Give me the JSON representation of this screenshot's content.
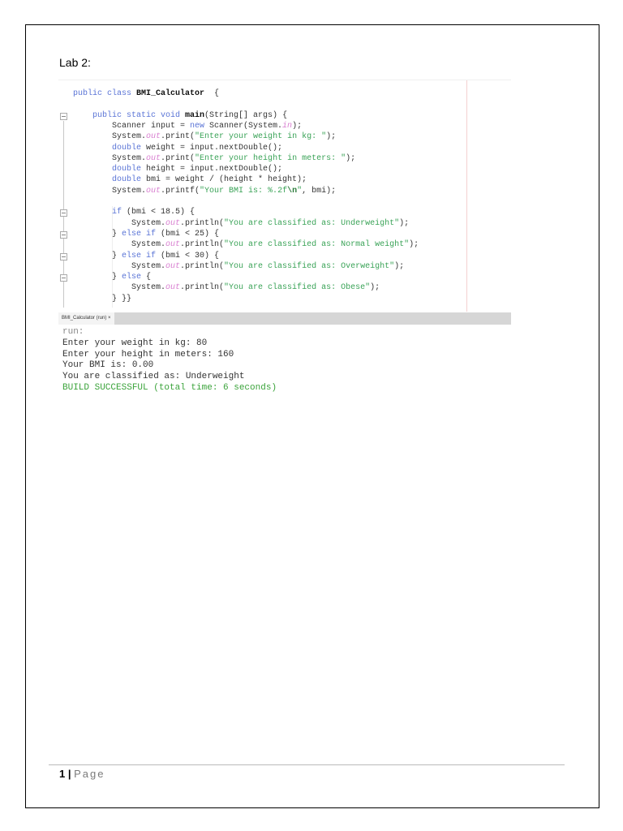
{
  "document": {
    "heading": "Lab 2:"
  },
  "code_lines": [
    {
      "indent": 0,
      "tokens": [
        [
          "kw",
          "public class "
        ],
        [
          "bold",
          "BMI_Calculator"
        ],
        [
          "",
          "  {"
        ]
      ]
    },
    {
      "indent": 0,
      "tokens": []
    },
    {
      "indent": 1,
      "fold": true,
      "tokens": [
        [
          "kw",
          "public static void "
        ],
        [
          "bold",
          "main"
        ],
        [
          "",
          "(String[] args) {"
        ]
      ]
    },
    {
      "indent": 2,
      "tokens": [
        [
          "",
          "Scanner input = "
        ],
        [
          "kw",
          "new "
        ],
        [
          "",
          "Scanner(System."
        ],
        [
          "fld",
          "in"
        ],
        [
          "",
          ");"
        ]
      ]
    },
    {
      "indent": 2,
      "tokens": [
        [
          "",
          "System."
        ],
        [
          "fld",
          "out"
        ],
        [
          "",
          ".print("
        ],
        [
          "str",
          "\"Enter your weight in kg: \""
        ],
        [
          "",
          ");"
        ]
      ]
    },
    {
      "indent": 2,
      "tokens": [
        [
          "kw",
          "double "
        ],
        [
          "",
          "weight = input.nextDouble();"
        ]
      ]
    },
    {
      "indent": 2,
      "tokens": [
        [
          "",
          "System."
        ],
        [
          "fld",
          "out"
        ],
        [
          "",
          ".print("
        ],
        [
          "str",
          "\"Enter your height in meters: \""
        ],
        [
          "",
          ");"
        ]
      ]
    },
    {
      "indent": 2,
      "tokens": [
        [
          "kw",
          "double "
        ],
        [
          "",
          "height = input.nextDouble();"
        ]
      ]
    },
    {
      "indent": 2,
      "tokens": [
        [
          "kw",
          "double "
        ],
        [
          "",
          "bmi = weight / (height * height);"
        ]
      ]
    },
    {
      "indent": 2,
      "tokens": [
        [
          "",
          "System."
        ],
        [
          "fld",
          "out"
        ],
        [
          "",
          ".printf("
        ],
        [
          "str",
          "\"Your BMI is: %.2f"
        ],
        [
          "esc",
          "\\n"
        ],
        [
          "str",
          "\""
        ],
        [
          "",
          ", bmi);"
        ]
      ]
    },
    {
      "indent": 0,
      "tokens": []
    },
    {
      "indent": 2,
      "fold": true,
      "tokens": [
        [
          "kw",
          "if "
        ],
        [
          "",
          "(bmi < 18.5) {"
        ]
      ]
    },
    {
      "indent": 3,
      "tokens": [
        [
          "",
          "System."
        ],
        [
          "fld",
          "out"
        ],
        [
          "",
          ".println("
        ],
        [
          "str",
          "\"You are classified as: Underweight\""
        ],
        [
          "",
          ");"
        ]
      ]
    },
    {
      "indent": 2,
      "fold": true,
      "tokens": [
        [
          "",
          "} "
        ],
        [
          "kw",
          "else if "
        ],
        [
          "",
          "(bmi < 25) {"
        ]
      ]
    },
    {
      "indent": 3,
      "tokens": [
        [
          "",
          "System."
        ],
        [
          "fld",
          "out"
        ],
        [
          "",
          ".println("
        ],
        [
          "str",
          "\"You are classified as: Normal weight\""
        ],
        [
          "",
          ");"
        ]
      ]
    },
    {
      "indent": 2,
      "fold": true,
      "tokens": [
        [
          "",
          "} "
        ],
        [
          "kw",
          "else if "
        ],
        [
          "",
          "(bmi < 30) {"
        ]
      ]
    },
    {
      "indent": 3,
      "tokens": [
        [
          "",
          "System."
        ],
        [
          "fld",
          "out"
        ],
        [
          "",
          ".println("
        ],
        [
          "str",
          "\"You are classified as: Overweight\""
        ],
        [
          "",
          ");"
        ]
      ]
    },
    {
      "indent": 2,
      "fold": true,
      "tokens": [
        [
          "",
          "} "
        ],
        [
          "kw",
          "else "
        ],
        [
          "",
          "{"
        ]
      ]
    },
    {
      "indent": 3,
      "tokens": [
        [
          "",
          "System."
        ],
        [
          "fld",
          "out"
        ],
        [
          "",
          ".println("
        ],
        [
          "str",
          "\"You are classified as: Obese\""
        ],
        [
          "",
          ");"
        ]
      ]
    },
    {
      "indent": 2,
      "tokens": [
        [
          "",
          "} }}"
        ]
      ]
    }
  ],
  "output": {
    "tab_label": "BMI_Calculator (run)",
    "tab_close": "×",
    "lines": [
      {
        "text": "run:",
        "style": "gray"
      },
      {
        "text": "Enter your weight in kg: 80",
        "style": ""
      },
      {
        "text": "Enter your height in meters: 160",
        "style": ""
      },
      {
        "text": "Your BMI is: 0.00",
        "style": ""
      },
      {
        "text": "You are classified as: Underweight",
        "style": ""
      },
      {
        "text": "BUILD SUCCESSFUL (total time: 6 seconds)",
        "style": "green"
      }
    ]
  },
  "footer": {
    "page_number": "1",
    "separator": "|",
    "page_label": "Page"
  }
}
